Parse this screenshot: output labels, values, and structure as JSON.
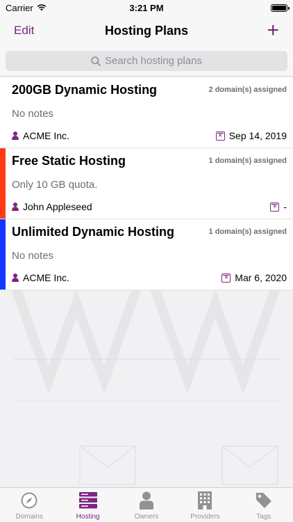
{
  "status": {
    "carrier": "Carrier",
    "time": "3:21 PM"
  },
  "nav": {
    "edit_label": "Edit",
    "title": "Hosting Plans",
    "add_symbol": "+"
  },
  "search": {
    "placeholder": "Search hosting plans"
  },
  "plans": [
    {
      "title": "200GB Dynamic Hosting",
      "count": "2 domain(s) assigned",
      "notes": "No notes",
      "owner": "ACME Inc.",
      "date": "Sep 14, 2019",
      "stripe_color": ""
    },
    {
      "title": "Free Static Hosting",
      "count": "1 domain(s) assigned",
      "notes": "Only 10 GB quota.",
      "owner": "John Appleseed",
      "date": "-",
      "stripe_color": "#ff3b15"
    },
    {
      "title": "Unlimited Dynamic Hosting",
      "count": "1 domain(s) assigned",
      "notes": "No notes",
      "owner": "ACME Inc.",
      "date": "Mar 6, 2020",
      "stripe_color": "#1437ff"
    }
  ],
  "tabs": [
    {
      "label": "Domains",
      "icon": "compass-icon",
      "active": false
    },
    {
      "label": "Hosting",
      "icon": "server-icon",
      "active": true
    },
    {
      "label": "Owners",
      "icon": "person-icon",
      "active": false
    },
    {
      "label": "Providers",
      "icon": "building-icon",
      "active": false
    },
    {
      "label": "Tags",
      "icon": "tag-icon",
      "active": false
    }
  ],
  "colors": {
    "accent": "#7e2481",
    "inactive_tab": "#929292"
  }
}
